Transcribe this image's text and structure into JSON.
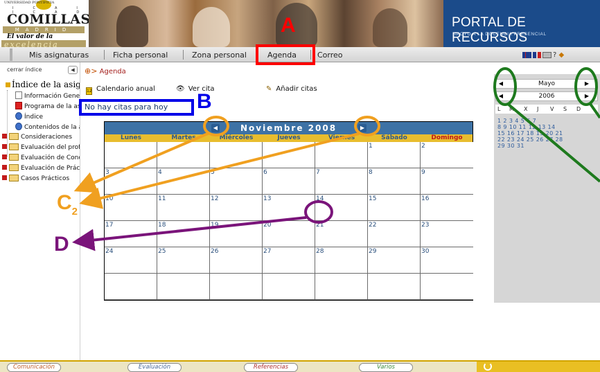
{
  "logo": {
    "university": "UNIVERSIDAD PONTIFICIA",
    "icai_icade": "ICAI  ICADE",
    "name": "COMILLAS",
    "city": "MADRID",
    "motto": "El valor de la",
    "motto2": "excelencia"
  },
  "portal": {
    "title": "PORTAL DE RECURSOS",
    "subtitle": "APOYO A LA DOCENCIA PRESENCIAL"
  },
  "nav": {
    "items": [
      {
        "label": "Mis asignaturas"
      },
      {
        "label": "Ficha personal"
      },
      {
        "label": "Zona personal"
      },
      {
        "label": "Agenda"
      },
      {
        "label": "Correo"
      }
    ],
    "right_icons_text": "? "
  },
  "left": {
    "close_index": "cerrar índice",
    "index_title": "Índice de la asignatura",
    "tree": [
      {
        "label": "Información General",
        "icon": "page-icon",
        "expand": false
      },
      {
        "label": "Programa de la asignatura",
        "icon": "pdf-icon",
        "expand": false
      },
      {
        "label": "Índice",
        "icon": "web-icon",
        "expand": false
      },
      {
        "label": "Contenidos de la asignatura",
        "icon": "web-icon",
        "expand": false
      },
      {
        "label": "Consideraciones",
        "icon": "folder-icon",
        "expand": true
      },
      {
        "label": "Evaluación del profesor",
        "icon": "folder-icon",
        "expand": true
      },
      {
        "label": "Evaluación de Conocimientos",
        "icon": "folder-icon",
        "expand": true
      },
      {
        "label": "Evaluación de Prácticas",
        "icon": "folder-icon",
        "expand": true
      },
      {
        "label": "Casos Prácticos",
        "icon": "folder-icon",
        "expand": true
      }
    ]
  },
  "breadcrumb": {
    "prefix": "⊕>",
    "current": "Agenda"
  },
  "toolbar": {
    "annual": "Calendario anual",
    "view": "Ver cita",
    "add": "Añadir citas",
    "calendar_icon_text": "12"
  },
  "no_appointments": "No hay citas para hoy",
  "calendar": {
    "title": "Noviembre 2008",
    "days": [
      "Lunes",
      "Martes",
      "Miércoles",
      "Jueves",
      "Viernes",
      "Sábado",
      "Domingo"
    ],
    "weeks": [
      [
        "",
        "",
        "",
        "",
        "",
        "1",
        "2"
      ],
      [
        "3",
        "4",
        "5",
        "6",
        "7",
        "8",
        "9"
      ],
      [
        "10",
        "11",
        "12",
        "13",
        "14",
        "15",
        "16"
      ],
      [
        "17",
        "18",
        "19",
        "20",
        "21",
        "22",
        "23"
      ],
      [
        "24",
        "25",
        "26",
        "27",
        "28",
        "29",
        "30"
      ],
      [
        "",
        "",
        "",
        "",
        "",
        "",
        ""
      ]
    ]
  },
  "mini_calendar": {
    "month": "Mayo",
    "year": "2006",
    "day_heads": [
      "L",
      "M",
      "X",
      "J",
      "V",
      "S",
      "D"
    ],
    "rows": [
      "1  2  3  4  5  6  7",
      "8  9  10 11 12 13 14",
      "15 16 17 18 19 20 21",
      "22 23 24 25 26 27 28",
      "29 30 31"
    ]
  },
  "footer": {
    "tabs": [
      {
        "label": "Comunicación",
        "color": "#c06030"
      },
      {
        "label": "Evaluación",
        "color": "#4a6a9a"
      },
      {
        "label": "Referencias",
        "color": "#b03030"
      },
      {
        "label": "Varios",
        "color": "#3a8a3a"
      }
    ]
  },
  "annotations": {
    "A": "A",
    "B": "B",
    "C": "C",
    "C_sub": "2",
    "D": "D",
    "colors": {
      "A": "#ff0000",
      "B": "#0000e8",
      "C": "#f0a020",
      "D": "#7a147a",
      "green": "#1e7a1e"
    }
  }
}
